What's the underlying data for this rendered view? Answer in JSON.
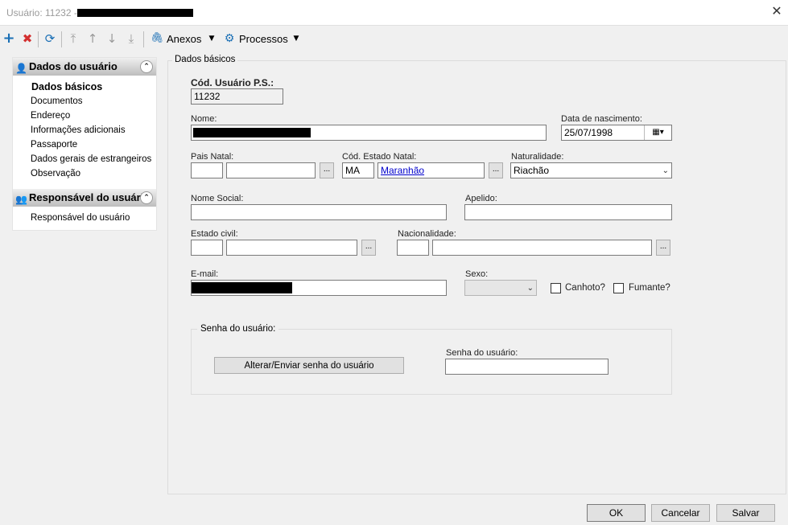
{
  "window": {
    "title": "Usuário: 11232 -",
    "close_icon": "close-icon"
  },
  "toolbar": {
    "add_icon": "plus-icon",
    "delete_icon": "x-icon",
    "refresh_icon": "refresh-icon",
    "first_icon": "arrow-top-icon",
    "up_icon": "arrow-up-icon",
    "down_icon": "arrow-down-icon",
    "last_icon": "arrow-bottom-icon",
    "attachments_label": "Anexos",
    "processes_label": "Processos"
  },
  "sidebar": {
    "section1_title": "Dados do usuário",
    "section1_items": [
      "Dados básicos",
      "Documentos",
      "Endereço",
      "Informações adicionais",
      "Passaporte",
      "Dados gerais de estrangeiros",
      "Observação"
    ],
    "section2_title": "Responsável do usuário",
    "section2_items": [
      "Responsável do usuário"
    ]
  },
  "form": {
    "group_title": "Dados básicos",
    "cod_label": "Cód. Usuário P.S.:",
    "cod_value": "11232",
    "nome_label": "Nome:",
    "nascimento_label": "Data de nascimento:",
    "nascimento_value": "25/07/1998",
    "pais_label": "Pais Natal:",
    "pais_btn": "...",
    "estado_label": "Cód. Estado Natal:",
    "estado_code": "MA",
    "estado_name": "Maranhão",
    "estado_btn": "...",
    "naturalidade_label": "Naturalidade:",
    "naturalidade_value": "Riachão",
    "nome_social_label": "Nome Social:",
    "apelido_label": "Apelido:",
    "estado_civil_label": "Estado civil:",
    "estado_civil_btn": "...",
    "nacionalidade_label": "Nacionalidade:",
    "nacionalidade_btn": "...",
    "email_label": "E-mail:",
    "sexo_label": "Sexo:",
    "canhoto_label": "Canhoto?",
    "fumante_label": "Fumante?",
    "senha_group_title": "Senha do usuário:",
    "senha_button": "Alterar/Enviar senha do usuário",
    "senha_label": "Senha do usuário:"
  },
  "footer": {
    "ok": "OK",
    "cancel": "Cancelar",
    "save": "Salvar"
  }
}
